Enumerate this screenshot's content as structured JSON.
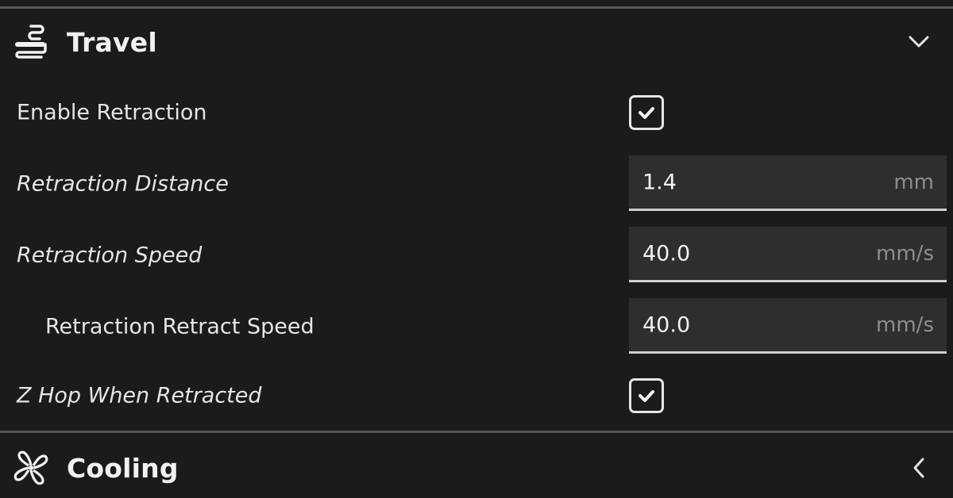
{
  "travel_section": {
    "title": "Travel",
    "icon": "travel-icon",
    "expanded": true,
    "settings": [
      {
        "label": "Enable Retraction",
        "type": "checkbox",
        "checked": true
      },
      {
        "label": "Retraction Distance",
        "type": "number",
        "value": "1.4",
        "unit": "mm"
      },
      {
        "label": "Retraction Speed",
        "type": "number",
        "value": "40.0",
        "unit": "mm/s"
      },
      {
        "label": "Retraction Retract Speed",
        "type": "number",
        "value": "40.0",
        "unit": "mm/s"
      },
      {
        "label": "Z Hop When Retracted",
        "type": "checkbox",
        "checked": true
      }
    ]
  },
  "cooling_section": {
    "title": "Cooling",
    "icon": "fan-icon",
    "expanded": false
  },
  "colors": {
    "background": "#1b1b1b",
    "field_background": "#2e2e2e",
    "divider": "#575757",
    "text": "#e6e6e6",
    "unit_text": "#8d8d8d"
  }
}
